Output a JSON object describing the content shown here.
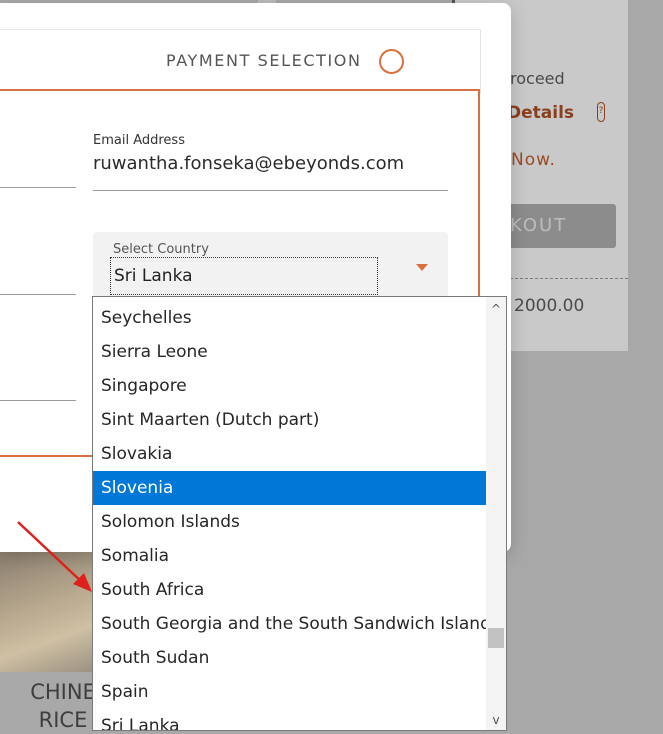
{
  "background": {
    "proceed_text": "roceed",
    "details_text": "y Details",
    "help_glyph": "?",
    "now_text": "Now.",
    "checkout_label": "KOUT",
    "total_text": "2000.00",
    "product_title": "CHINE\nRICE"
  },
  "modal": {
    "step_label": "PAYMENT SELECTION",
    "email": {
      "label": "Email Address",
      "value": "ruwantha.fonseka@ebeyonds.com"
    },
    "country": {
      "label": "Select Country",
      "value": "Sri Lanka"
    }
  },
  "dropdown": {
    "options": [
      "Seychelles",
      "Sierra Leone",
      "Singapore",
      "Sint Maarten (Dutch part)",
      "Slovakia",
      "Slovenia",
      "Solomon Islands",
      "Somalia",
      "South Africa",
      "South Georgia and the South Sandwich Islands",
      "South Sudan",
      "Spain",
      "Sri Lanka"
    ],
    "selected": "Slovenia",
    "scroll_up_glyph": "^",
    "scroll_down_glyph": "v"
  },
  "colors": {
    "accent": "#d9703f",
    "selection": "#0078d7",
    "annotation_arrow": "#e0201d"
  }
}
